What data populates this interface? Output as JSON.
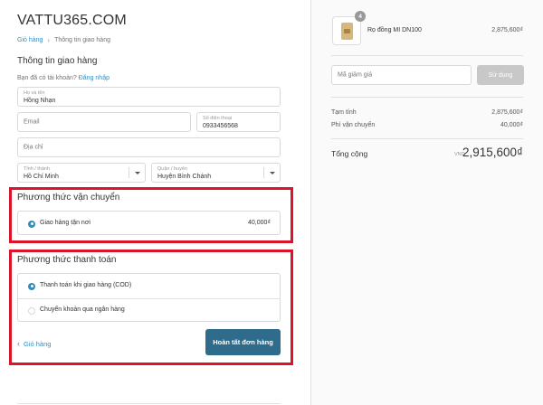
{
  "store": {
    "title": "VATTU365.COM"
  },
  "breadcrumb": {
    "cart": "Giỏ hàng",
    "separator": "›",
    "current": "Thông tin giao hàng"
  },
  "shipping_info": {
    "title": "Thông tin giao hàng",
    "login_prompt": "Bạn đã có tài khoản?",
    "login_link": "Đăng nhập",
    "name": {
      "label": "Họ và tên",
      "value": "Hồng Nhạn"
    },
    "email": {
      "placeholder": "Email"
    },
    "phone": {
      "label": "Số điện thoại",
      "value": "0933456568"
    },
    "address": {
      "placeholder": "Địa chỉ"
    },
    "province": {
      "label": "Tỉnh / thành",
      "value": "Hồ Chí Minh"
    },
    "district": {
      "label": "Quận / huyện",
      "value": "Huyện Bình Chánh"
    }
  },
  "shipping_method": {
    "title": "Phương thức vận chuyển",
    "options": [
      {
        "label": "Giao hàng tận nơi",
        "price": "40,000₫",
        "selected": true
      }
    ]
  },
  "payment_method": {
    "title": "Phương thức thanh toán",
    "options": [
      {
        "label": "Thanh toán khi giao hàng (COD)",
        "selected": true
      },
      {
        "label": "Chuyển khoản qua ngân hàng",
        "selected": false
      }
    ]
  },
  "actions": {
    "back_label": "Giỏ hàng",
    "submit_label": "Hoàn tất đơn hàng"
  },
  "order": {
    "product": {
      "name": "Rọ đồng MI DN100",
      "quantity": "4",
      "price": "2,875,600₫"
    },
    "coupon": {
      "placeholder": "Mã giảm giá",
      "button": "Sử dụng"
    },
    "subtotal": {
      "label": "Tạm tính",
      "value": "2,875,600₫"
    },
    "shipping": {
      "label": "Phí vận chuyển",
      "value": "40,000₫"
    },
    "total": {
      "label": "Tổng cộng",
      "currency": "VND",
      "value": "2,915,600₫"
    }
  },
  "colors": {
    "accent": "#338dbc",
    "highlight": "#d9142b",
    "button": "#2f6b8a"
  },
  "icons": {
    "breadcrumb_separator": "chevron-right-icon",
    "back": "chevron-left-icon",
    "select": "caret-down-icon",
    "radio": "radio-icon"
  }
}
